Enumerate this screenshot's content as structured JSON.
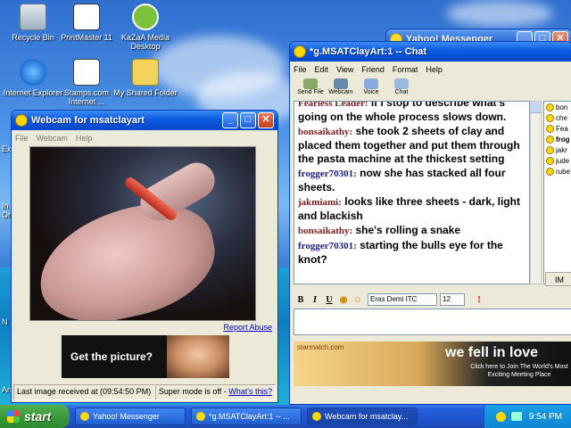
{
  "desktop": {
    "icons": [
      {
        "label": "Recycle Bin"
      },
      {
        "label": "PrintMaster 11"
      },
      {
        "label": "KaZaA Media Desktop"
      },
      {
        "label": "Internet Explorer"
      },
      {
        "label": "Stamps.com Internet ..."
      },
      {
        "label": "My Shared Folder"
      }
    ],
    "edge_labels": [
      "Ex",
      "In",
      "Or",
      "N",
      "An"
    ]
  },
  "yahoo_messenger": {
    "title": "Yahoo! Messenger"
  },
  "webcam_window": {
    "title": "Webcam for msatclayart",
    "menu": [
      "File",
      "Webcam",
      "Help"
    ],
    "report_abuse": "Report Abuse",
    "ad_text": "Get the picture?",
    "status_last_image": "Last image received at (09:54:50 PM)",
    "status_super_mode": "Super mode is off -",
    "status_whats_this": "What's this?"
  },
  "chat_window": {
    "title": "*g.MSATClayArt:1 -- Chat",
    "menu": [
      "File",
      "Edit",
      "View",
      "Friend",
      "Format",
      "Help"
    ],
    "toolbar": [
      {
        "label": "Send File",
        "icon": "send-file-icon"
      },
      {
        "label": "Webcam",
        "icon": "webcam-icon"
      },
      {
        "label": "Voice",
        "icon": "voice-icon"
      },
      {
        "label": "Chat",
        "icon": "chat-icon"
      }
    ],
    "messages": [
      {
        "who": "Fearless Leader:",
        "text": "If I stop to describe what's going on the whole process slows down."
      },
      {
        "who": "bonsaikathy:",
        "text": "she took 2 sheets of clay and placed them together and put them through the pasta machine at the thickest setting"
      },
      {
        "who": "frogger70301:",
        "text": "now she has stacked all four sheets."
      },
      {
        "who": "jakmiami:",
        "text": "looks like three sheets - dark, light and blackish"
      },
      {
        "who": "bonsaikathy:",
        "text": "she's rolling a snake"
      },
      {
        "who": "frogger70301:",
        "text": "starting the bulls eye for the knot?"
      }
    ],
    "users": [
      {
        "name": "bon",
        "bold": false
      },
      {
        "name": "che",
        "bold": false
      },
      {
        "name": "Fea",
        "bold": false
      },
      {
        "name": "frog",
        "bold": true
      },
      {
        "name": "jakr",
        "bold": false
      },
      {
        "name": "jude",
        "bold": false
      },
      {
        "name": "rube",
        "bold": false
      }
    ],
    "im_button": "IM",
    "format": {
      "bold": "B",
      "italic": "I",
      "underline": "U",
      "font": "Eras Demi ITC",
      "size": "12"
    },
    "banner": {
      "site": "starmatch.com",
      "headline": "we fell in love",
      "sub": "Click here to Join The World's Most Exciting Meeting Place"
    }
  },
  "taskbar": {
    "start": "start",
    "tasks": [
      {
        "label": "Yahoo! Messenger",
        "active": false
      },
      {
        "label": "*g.MSATClayArt:1 -- ...",
        "active": false
      },
      {
        "label": "Webcam for msatclay...",
        "active": true
      }
    ],
    "clock": "9:54 PM"
  },
  "colors": {
    "title_blue": "#0a5ae0",
    "taskbar_blue": "#245ddb",
    "start_green": "#3c9a3c"
  }
}
